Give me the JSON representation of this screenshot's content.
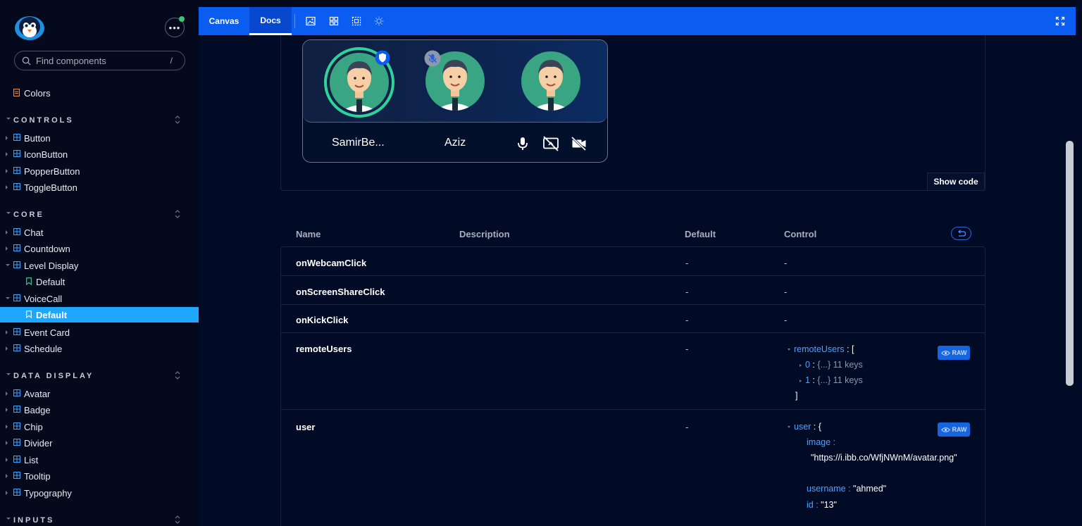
{
  "sidebar": {
    "search_placeholder": "Find components",
    "search_shortcut": "/",
    "colors_label": "Colors",
    "sections": [
      {
        "label": "CONTROLS",
        "items": [
          "Button",
          "IconButton",
          "PopperButton",
          "ToggleButton"
        ]
      },
      {
        "label": "CORE",
        "items": [
          "Chat",
          "Countdown",
          "Level Display",
          "Default",
          "VoiceCall",
          "Default",
          "Event Card",
          "Schedule"
        ]
      },
      {
        "label": "DATA DISPLAY",
        "items": [
          "Avatar",
          "Badge",
          "Chip",
          "Divider",
          "List",
          "Tooltip",
          "Typography"
        ]
      },
      {
        "label": "INPUTS",
        "items": []
      }
    ],
    "menu_icon": "ellipsis-icon"
  },
  "toolbar": {
    "tabs": [
      "Canvas",
      "Docs"
    ],
    "active_tab": "Docs",
    "icons": [
      "image-icon",
      "grid-icon",
      "outline-icon",
      "background-icon",
      "fullscreen-icon"
    ]
  },
  "preview": {
    "users": [
      {
        "name": "SamirBe...",
        "speaking": true,
        "badge": "shield-icon"
      },
      {
        "name": "Aziz",
        "muted": true,
        "badge": "mic-off-icon"
      },
      {
        "name": "",
        "speaking": false
      }
    ],
    "controls": [
      "mic-icon",
      "screen-share-off-icon",
      "webcam-off-icon"
    ],
    "show_code_label": "Show code"
  },
  "props_table": {
    "headers": {
      "name": "Name",
      "description": "Description",
      "default": "Default",
      "control": "Control"
    },
    "rows": [
      {
        "name": "onWebcamClick",
        "default": "-",
        "control": "-"
      },
      {
        "name": "onScreenShareClick",
        "default": "-",
        "control": "-"
      },
      {
        "name": "onKickClick",
        "default": "-",
        "control": "-"
      },
      {
        "name": "remoteUsers",
        "default": "-",
        "raw_label": "RAW",
        "json": {
          "root": "remoteUsers",
          "open": "[",
          "close": "]",
          "items": [
            {
              "key": "0",
              "summary": "{...} 11 keys"
            },
            {
              "key": "1",
              "summary": "{...} 11 keys"
            }
          ]
        }
      },
      {
        "name": "user",
        "default": "-",
        "raw_label": "RAW",
        "json": {
          "root": "user",
          "open": "{",
          "fields": [
            {
              "key": "image",
              "value": "\"https://i.ibb.co/WfjNWnM/avatar.png\""
            },
            {
              "key": "username",
              "value": "\"ahmed\""
            },
            {
              "key": "id",
              "value": "\"13\""
            }
          ]
        }
      }
    ]
  },
  "colors": {
    "toolbar_bg": "#0a5df0",
    "active_nav": "#1ea7fd",
    "speaking_ring": "#2fd39a",
    "json_key": "#4aa3ff"
  }
}
